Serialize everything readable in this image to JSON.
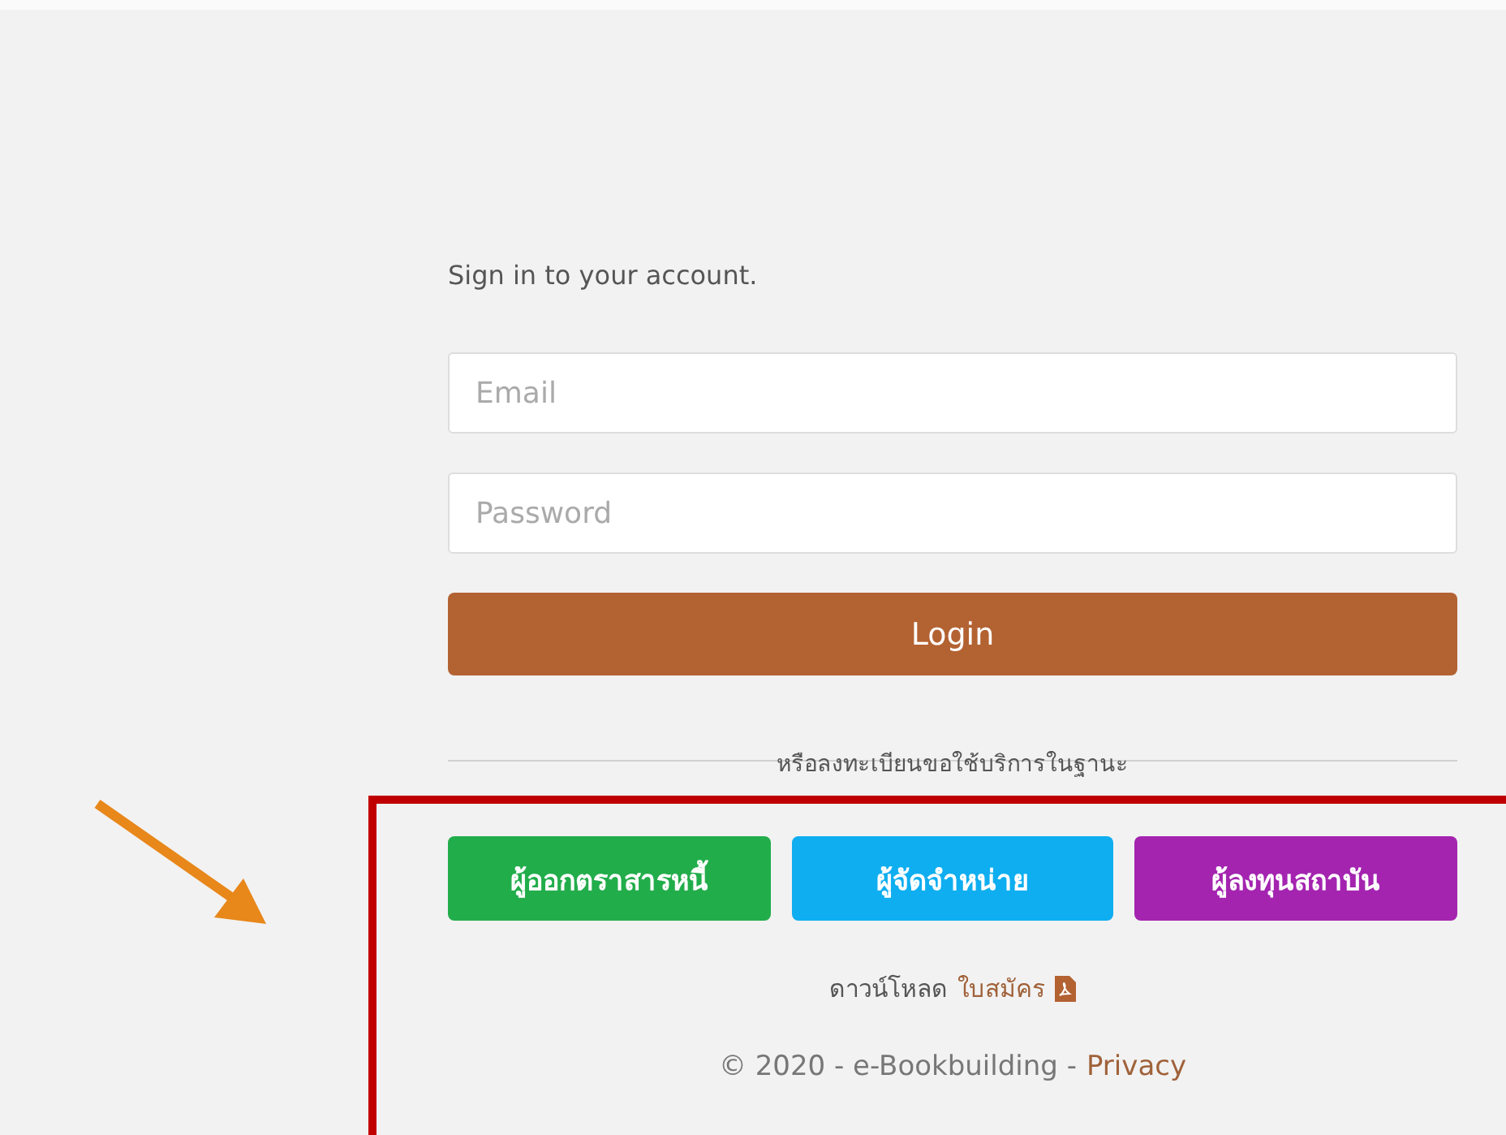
{
  "heading": "Sign in to your account.",
  "email_field": {
    "placeholder": "Email"
  },
  "password_field": {
    "placeholder": "Password"
  },
  "login_button": "Login",
  "register_caption": "หรือลงทะเบียนขอใช้บริการในฐานะ",
  "roles": [
    {
      "label": "ผู้ออกตราสารหนี้",
      "color": "#22ad4b"
    },
    {
      "label": "ผู้จัดจำหน่าย",
      "color": "#0eaef0"
    },
    {
      "label": "ผู้ลงทุนสถาบัน",
      "color": "#a424b0"
    }
  ],
  "download": {
    "text": "ดาวน์โหลด",
    "link": "ใบสมัคร"
  },
  "footer": {
    "text": "© 2020 - e-Bookbuilding -",
    "link": "Privacy"
  }
}
